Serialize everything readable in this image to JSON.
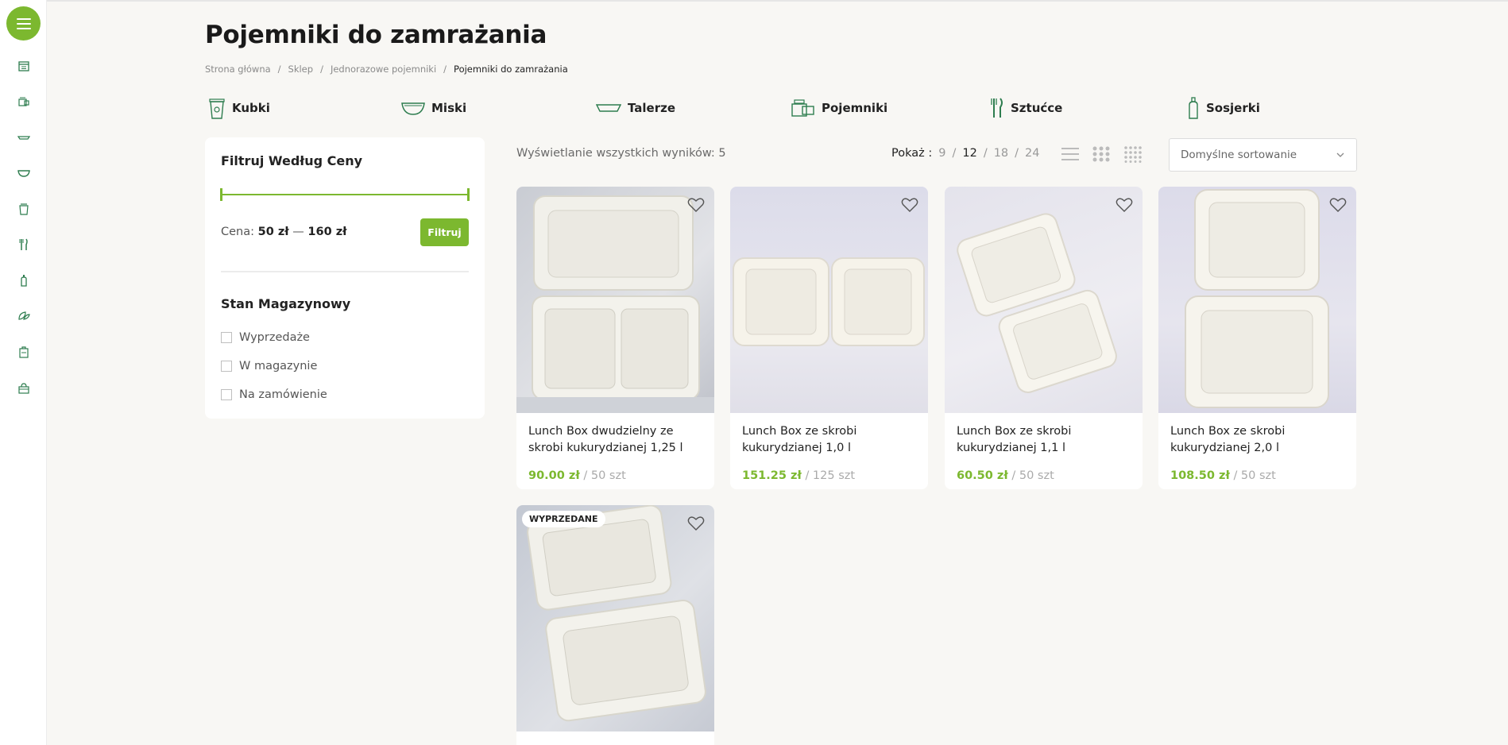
{
  "page": {
    "title": "Pojemniki do zamrażania",
    "breadcrumb": [
      "Strona główna",
      "Sklep",
      "Jednorazowe pojemniki",
      "Pojemniki do zamrażania"
    ]
  },
  "sidebar_icons": [
    "calendar-icon",
    "container-icon",
    "plate-icon",
    "bowl-icon",
    "cup-icon",
    "cutlery-icon",
    "bottle-icon",
    "leaf-icon",
    "bag-icon",
    "gift-box-icon"
  ],
  "categories": [
    {
      "label": "Kubki",
      "icon": "cup-icon"
    },
    {
      "label": "Miski",
      "icon": "bowl-icon"
    },
    {
      "label": "Talerze",
      "icon": "plate-icon"
    },
    {
      "label": "Pojemniki",
      "icon": "container-icon"
    },
    {
      "label": "Sztućce",
      "icon": "cutlery-icon"
    },
    {
      "label": "Sosjerki",
      "icon": "bottle-icon"
    }
  ],
  "filter": {
    "title": "Filtruj Według Ceny",
    "price_label": "Cena:",
    "price_min": "50 zł",
    "price_sep": "—",
    "price_max": "160 zł",
    "button": "Filtruj",
    "stock_title": "Stan Magazynowy",
    "stock_options": [
      "Wyprzedaże",
      "W magazynie",
      "Na zamówienie"
    ]
  },
  "toolbar": {
    "result_count": "Wyświetlanie wszystkich wyników: 5",
    "show_label": "Pokaż :",
    "show_options": [
      "9",
      "12",
      "18",
      "24"
    ],
    "show_selected": "12",
    "sort_label": "Domyślne sortowanie"
  },
  "products": [
    {
      "name": "Lunch Box dwudzielny ze skrobi kukurydzianej 1,25 l",
      "price": "90.00 zł",
      "unit": "/ 50 szt",
      "badge": ""
    },
    {
      "name": "Lunch Box ze skrobi kukurydzianej 1,0 l",
      "price": "151.25 zł",
      "unit": "/ 125 szt",
      "badge": ""
    },
    {
      "name": "Lunch Box ze skrobi kukurydzianej 1,1 l",
      "price": "60.50 zł",
      "unit": "/ 50 szt",
      "badge": ""
    },
    {
      "name": "Lunch Box ze skrobi kukurydzianej 2,0 l",
      "price": "108.50 zł",
      "unit": "/ 50 szt",
      "badge": ""
    },
    {
      "name": "",
      "price": "",
      "unit": "",
      "badge": "WYPRZEDANE"
    }
  ],
  "colors": {
    "accent": "#7cb82f",
    "background": "#f8f7f4",
    "icon_green": "#2e7d4f"
  }
}
